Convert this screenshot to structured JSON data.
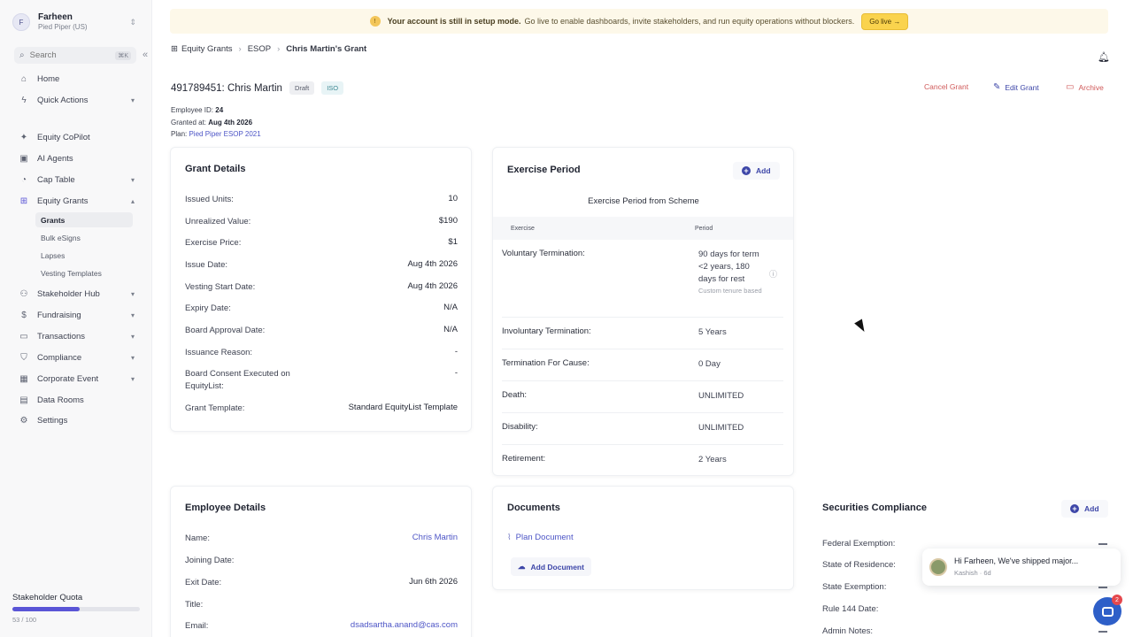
{
  "workspace": {
    "initial": "F",
    "name": "Farheen",
    "company": "Pied Piper (US)"
  },
  "search": {
    "placeholder": "Search",
    "shortcut": "⌘K"
  },
  "sidebar": {
    "items": [
      {
        "label": "Home",
        "icon": "home-icon"
      },
      {
        "label": "Quick Actions",
        "icon": "bolt-icon"
      },
      {
        "label": "Equity CoPilot",
        "icon": "sparkle-icon"
      },
      {
        "label": "AI Agents",
        "icon": "robot-icon"
      },
      {
        "label": "Cap Table",
        "icon": "pie-icon"
      },
      {
        "label": "Equity Grants",
        "icon": "gift-icon"
      },
      {
        "label": "Stakeholder Hub",
        "icon": "people-icon"
      },
      {
        "label": "Fundraising",
        "icon": "dollar-icon"
      },
      {
        "label": "Transactions",
        "icon": "card-icon"
      },
      {
        "label": "Compliance",
        "icon": "shield-icon"
      },
      {
        "label": "Corporate Event",
        "icon": "calendar-icon"
      },
      {
        "label": "Data Rooms",
        "icon": "folder-icon"
      },
      {
        "label": "Settings",
        "icon": "gear-icon"
      }
    ],
    "grants_sub": [
      "Grants",
      "Bulk eSigns",
      "Lapses",
      "Vesting Templates"
    ],
    "quota": {
      "label": "Stakeholder Quota",
      "count": "53 / 100",
      "fraction": 0.53
    }
  },
  "banner": {
    "bold": "Your account is still in setup mode.",
    "text": "Go live to enable dashboards, invite stakeholders, and run equity operations without blockers.",
    "button": "Go live →"
  },
  "breadcrumb": {
    "root": "Equity Grants",
    "mid": "ESOP",
    "current": "Chris Martin's Grant"
  },
  "header": {
    "title": "491789451: Chris Martin",
    "badge_status": "Draft",
    "badge_type": "ISO",
    "employee_id_label": "Employee ID:",
    "employee_id": "24",
    "granted_label": "Granted at:",
    "granted": "Aug 4th 2026",
    "plan_label": "Plan:",
    "plan": "Pied Piper ESOP 2021",
    "cancel": "Cancel Grant",
    "edit": "Edit Grant",
    "archive": "Archive"
  },
  "grant_details": {
    "title": "Grant Details",
    "rows": [
      {
        "k": "Issued Units:",
        "v": "10"
      },
      {
        "k": "Unrealized Value:",
        "v": "$190"
      },
      {
        "k": "Exercise Price:",
        "v": "$1"
      },
      {
        "k": "Issue Date:",
        "v": "Aug 4th 2026"
      },
      {
        "k": "Vesting Start Date:",
        "v": "Aug 4th 2026"
      },
      {
        "k": "Expiry Date:",
        "v": "N/A"
      },
      {
        "k": "Board Approval Date:",
        "v": "N/A"
      },
      {
        "k": "Issuance Reason:",
        "v": "-"
      },
      {
        "k": "Board Consent Executed on EquityList:",
        "v": "-"
      },
      {
        "k": "Grant Template:",
        "v": "Standard EquityList Template"
      }
    ]
  },
  "exercise": {
    "title": "Exercise Period",
    "add": "Add",
    "subtitle": "Exercise Period from Scheme",
    "col1": "Exercise",
    "col2": "Period",
    "rows": [
      {
        "k": "Voluntary Termination:",
        "v": "90 days for term <2 years, 180 days for rest",
        "note": "Custom tenure based"
      },
      {
        "k": "Involuntary Termination:",
        "v": "5 Years"
      },
      {
        "k": "Termination For Cause:",
        "v": "0 Day"
      },
      {
        "k": "Death:",
        "v": "UNLIMITED"
      },
      {
        "k": "Disability:",
        "v": "UNLIMITED"
      },
      {
        "k": "Retirement:",
        "v": "2 Years"
      }
    ]
  },
  "employee": {
    "title": "Employee Details",
    "rows": [
      {
        "k": "Name:",
        "v": "Chris Martin"
      },
      {
        "k": "Joining Date:",
        "v": ""
      },
      {
        "k": "Exit Date:",
        "v": "Jun 6th 2026"
      },
      {
        "k": "Title:",
        "v": ""
      },
      {
        "k": "Email:",
        "v": "dsadsartha.anand@cas.com"
      }
    ]
  },
  "documents": {
    "title": "Documents",
    "link": "Plan Document",
    "add": "Add Document"
  },
  "securities": {
    "title": "Securities Compliance",
    "add": "Add",
    "rows": [
      "Federal Exemption:",
      "State of Residence:",
      "State Exemption:",
      "Rule 144 Date:",
      "Admin Notes:"
    ]
  },
  "toast": {
    "message": "Hi Farheen,  We've shipped major...",
    "author": "Kashish · 6d"
  },
  "chat": {
    "count": "2"
  },
  "colors": {
    "accent": "#3d46a8",
    "danger": "#d05a5a",
    "banner": "#fdf8e9"
  }
}
